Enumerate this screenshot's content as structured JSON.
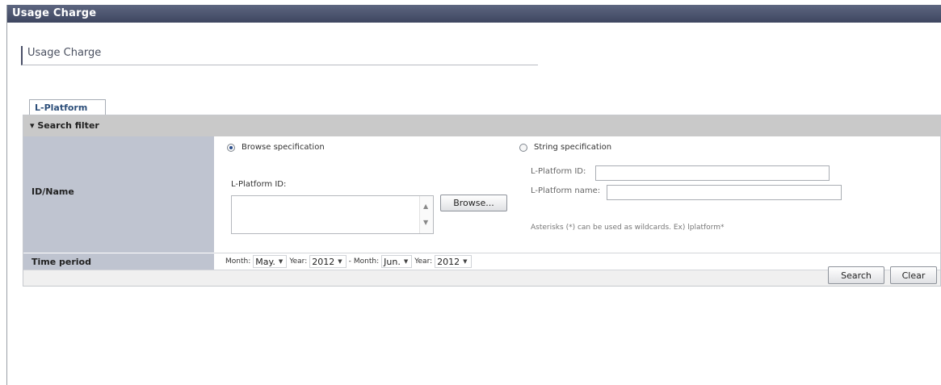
{
  "window": {
    "title": "Usage Charge"
  },
  "page": {
    "heading": "Usage Charge"
  },
  "tabs": [
    {
      "label": "L-Platform"
    }
  ],
  "search_filter": {
    "header": "▾ Search filter",
    "id_name": {
      "label": "ID/Name",
      "browse_option": "Browse specification",
      "browse_selected": true,
      "platform_id_label": "L-Platform ID:",
      "browse_button": "Browse...",
      "string_option": "String specification",
      "string_platform_id_label": "L-Platform ID:",
      "string_platform_name_label": "L-Platform name:",
      "string_platform_id_value": "",
      "string_platform_name_value": "",
      "hint": "Asterisks (*) can be used as wildcards. Ex) lplatform*"
    },
    "time_period": {
      "label": "Time period",
      "month_label": "Month:",
      "year_label": "Year:",
      "from_month": "May.",
      "from_year": "2012",
      "separator": "-",
      "to_month": "Jun.",
      "to_year": "2012"
    }
  },
  "actions": {
    "search": "Search",
    "clear": "Clear"
  },
  "icons": {
    "radio": "radio-button",
    "scroll_up": "scroll-up-arrow",
    "scroll_down": "scroll-down-arrow",
    "dropdown": "dropdown-arrow"
  },
  "colors": {
    "titlebar": "#4a5270",
    "row_label_bg": "#bfc4d0",
    "filter_header_bg": "#c9c9c9",
    "tab_text": "#2d4f7a"
  }
}
